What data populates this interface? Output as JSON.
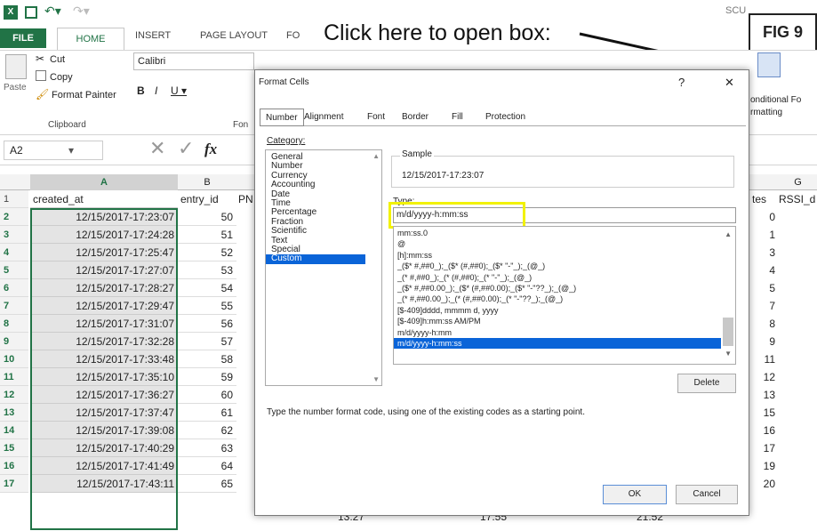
{
  "window": {
    "title_partial": "SCU"
  },
  "tabs": [
    "FILE",
    "HOME",
    "INSERT",
    "PAGE LAYOUT",
    "FO"
  ],
  "ribbon": {
    "cut": "Cut",
    "copy": "Copy",
    "paste": "Paste",
    "format_painter": "Format Painter",
    "clipboard": "Clipboard",
    "font_name": "Calibri",
    "font_group": "Fon",
    "cond_format_1": "onditional Fo",
    "cond_format_2": "rmatting"
  },
  "annotation": {
    "callout": "Click here to open box:",
    "fig": "FIG 9"
  },
  "formula_bar": {
    "name_box": "A2",
    "fx": "fx"
  },
  "columns": {
    "A": "A",
    "B": "B",
    "G": "G"
  },
  "sheet": {
    "headers": {
      "a": "created_at",
      "b": "entry_id",
      "c": "PN",
      "f": "tes",
      "g": "RSSI_d"
    },
    "rows": [
      {
        "n": "2",
        "a": "12/15/2017-17:23:07",
        "b": "50",
        "f": "0"
      },
      {
        "n": "3",
        "a": "12/15/2017-17:24:28",
        "b": "51",
        "f": "1"
      },
      {
        "n": "4",
        "a": "12/15/2017-17:25:47",
        "b": "52",
        "f": "3"
      },
      {
        "n": "5",
        "a": "12/15/2017-17:27:07",
        "b": "53",
        "f": "4"
      },
      {
        "n": "6",
        "a": "12/15/2017-17:28:27",
        "b": "54",
        "f": "5"
      },
      {
        "n": "7",
        "a": "12/15/2017-17:29:47",
        "b": "55",
        "f": "7"
      },
      {
        "n": "8",
        "a": "12/15/2017-17:31:07",
        "b": "56",
        "f": "8"
      },
      {
        "n": "9",
        "a": "12/15/2017-17:32:28",
        "b": "57",
        "f": "9"
      },
      {
        "n": "10",
        "a": "12/15/2017-17:33:48",
        "b": "58",
        "f": "11"
      },
      {
        "n": "11",
        "a": "12/15/2017-17:35:10",
        "b": "59",
        "f": "12"
      },
      {
        "n": "12",
        "a": "12/15/2017-17:36:27",
        "b": "60",
        "f": "13"
      },
      {
        "n": "13",
        "a": "12/15/2017-17:37:47",
        "b": "61",
        "f": "15"
      },
      {
        "n": "14",
        "a": "12/15/2017-17:39:08",
        "b": "62",
        "f": "16"
      },
      {
        "n": "15",
        "a": "12/15/2017-17:40:29",
        "b": "63",
        "f": "17"
      },
      {
        "n": "16",
        "a": "12/15/2017-17:41:49",
        "b": "64",
        "f": "19"
      },
      {
        "n": "17",
        "a": "12/15/2017-17:43:11",
        "b": "65",
        "f": "20"
      }
    ],
    "row17_extra": {
      "c": "13.27",
      "d": "17.55",
      "e": "21.52"
    }
  },
  "dialog": {
    "title": "Format Cells",
    "help": "?",
    "close": "✕",
    "tabs": [
      "Number",
      "Alignment",
      "Font",
      "Border",
      "Fill",
      "Protection"
    ],
    "category_label": "Category:",
    "categories": [
      "General",
      "Number",
      "Currency",
      "Accounting",
      "Date",
      "Time",
      "Percentage",
      "Fraction",
      "Scientific",
      "Text",
      "Special",
      "Custom"
    ],
    "sample_label": "Sample",
    "sample_value": "12/15/2017-17:23:07",
    "type_label": "Type:",
    "type_value": "m/d/yyyy-h:mm:ss",
    "type_list": [
      "mm:ss.0",
      "@",
      "[h]:mm:ss",
      "_($* #,##0_);_($* (#,##0);_($* \"-\"_);_(@_)",
      "_(* #,##0_);_(* (#,##0);_(* \"-\"_);_(@_)",
      "_($* #,##0.00_);_($* (#,##0.00);_($* \"-\"??_);_(@_)",
      "_(* #,##0.00_);_(* (#,##0.00);_(* \"-\"??_);_(@_)",
      "[$-409]dddd, mmmm d, yyyy",
      "[$-409]h:mm:ss AM/PM",
      "m/d/yyyy-h:mm",
      "m/d/yyyy-h:mm:ss"
    ],
    "delete": "Delete",
    "hint": "Type the number format code, using one of the existing codes as a starting point.",
    "ok": "OK",
    "cancel": "Cancel"
  },
  "colors": {
    "excel_green": "#217346",
    "highlight": "#f2f200",
    "selection": "#0a64d8"
  }
}
